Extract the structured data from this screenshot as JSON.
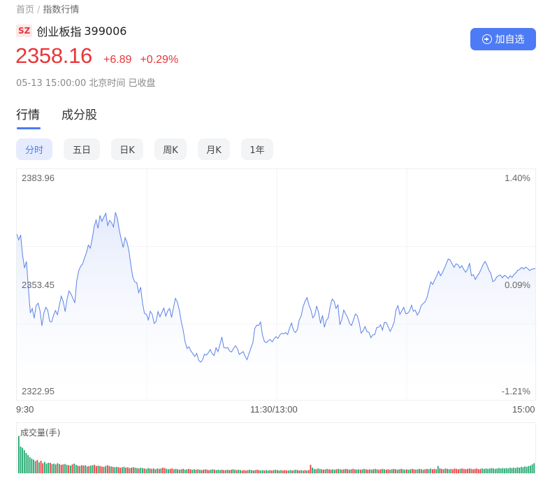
{
  "breadcrumb": {
    "home": "首页",
    "separator": "/",
    "current": "指数行情"
  },
  "index": {
    "market": "SZ",
    "name": "创业板指",
    "code": "399006"
  },
  "watch_button": {
    "label": "加自选",
    "icon": "plus-circle-icon"
  },
  "quote": {
    "price": "2358.16",
    "change": "+6.89",
    "change_pct": "+0.29%"
  },
  "status": "05-13 15:00:00 北京时间 已收盘",
  "tabs": [
    {
      "label": "行情",
      "active": true
    },
    {
      "label": "成分股",
      "active": false
    }
  ],
  "periods": [
    {
      "label": "分时",
      "active": true
    },
    {
      "label": "五日",
      "active": false
    },
    {
      "label": "日K",
      "active": false
    },
    {
      "label": "周K",
      "active": false
    },
    {
      "label": "月K",
      "active": false
    },
    {
      "label": "1年",
      "active": false
    }
  ],
  "colors": {
    "up": "#e8363a",
    "down": "#1aa56a",
    "line": "#5b82e8",
    "accent": "#4d7bf5"
  },
  "chart_data": {
    "type": "line",
    "y_left_ticks": [
      "2383.96",
      "2353.45",
      "2322.95"
    ],
    "y_right_ticks": [
      "1.40%",
      "0.09%",
      "-1.21%"
    ],
    "x_ticks": [
      "9:30",
      "11:30/13:00",
      "15:00"
    ],
    "ylim": [
      2322.95,
      2383.96
    ],
    "prev_close": 2351.27,
    "series": [
      {
        "values": [
          2368.2,
          2366.5,
          2367.9,
          2362.1,
          2358.4,
          2360.3,
          2352.7,
          2345.5,
          2346.8,
          2344.0,
          2347.6,
          2348.3,
          2346.2,
          2341.8,
          2345.4,
          2347.1,
          2346.3,
          2343.1,
          2342.9,
          2344.8,
          2346.2,
          2345.0,
          2347.7,
          2350.3,
          2348.8,
          2345.9,
          2349.5,
          2351.8,
          2351.0,
          2349.7,
          2348.4,
          2354.8,
          2357.6,
          2358.9,
          2359.5,
          2361.3,
          2362.8,
          2365.0,
          2364.1,
          2366.8,
          2370.3,
          2372.2,
          2369.8,
          2373.5,
          2371.8,
          2373.0,
          2374.1,
          2370.6,
          2372.1,
          2371.4,
          2370.2,
          2374.4,
          2372.7,
          2369.2,
          2366.6,
          2364.3,
          2367.1,
          2365.8,
          2363.2,
          2359.1,
          2355.7,
          2354.4,
          2354.2,
          2351.3,
          2352.9,
          2348.3,
          2345.4,
          2345.1,
          2343.5,
          2346.0,
          2345.1,
          2342.5,
          2343.1,
          2345.9,
          2344.4,
          2345.7,
          2346.9,
          2344.6,
          2346.1,
          2346.8,
          2344.2,
          2347.1,
          2349.7,
          2348.6,
          2346.3,
          2343.1,
          2340.6,
          2337.2,
          2335.3,
          2335.8,
          2334.6,
          2333.8,
          2333.0,
          2333.9,
          2331.9,
          2331.4,
          2332.0,
          2333.7,
          2333.4,
          2334.1,
          2335.0,
          2333.8,
          2333.3,
          2335.5,
          2334.4,
          2336.4,
          2338.6,
          2335.6,
          2335.4,
          2335.6,
          2334.6,
          2334.3,
          2335.3,
          2336.1,
          2335.3,
          2333.6,
          2334.0,
          2334.4,
          2333.1,
          2332.1,
          2333.8,
          2335.4,
          2337.0,
          2341.0,
          2342.0,
          2341.9,
          2342.9,
          2339.1,
          2337.3,
          2337.0,
          2337.5,
          2337.9,
          2337.2,
          2338.1,
          2338.7,
          2338.2,
          2339.2,
          2339.7,
          2339.5,
          2339.9,
          2339.3,
          2341.2,
          2342.6,
          2340.5,
          2339.9,
          2340.7,
          2343.5,
          2344.7,
          2347.3,
          2348.9,
          2349.9,
          2347.8,
          2346.4,
          2344.1,
          2344.9,
          2347.5,
          2345.6,
          2342.5,
          2344.8,
          2341.4,
          2343.4,
          2344.1,
          2347.4,
          2349.5,
          2348.9,
          2346.8,
          2347.8,
          2342.1,
          2343.7,
          2346.3,
          2345.2,
          2344.2,
          2342.5,
          2341.9,
          2343.5,
          2345.2,
          2344.7,
          2342.6,
          2339.7,
          2340.4,
          2341.6,
          2340.1,
          2340.0,
          2338.4,
          2339.2,
          2339.3,
          2341.3,
          2341.4,
          2342.1,
          2340.6,
          2342.8,
          2342.7,
          2341.5,
          2340.2,
          2341.4,
          2342.8,
          2346.4,
          2347.6,
          2345.1,
          2346.1,
          2347.1,
          2345.3,
          2345.4,
          2346.1,
          2347.7,
          2346.0,
          2346.3,
          2344.9,
          2345.8,
          2347.6,
          2348.2,
          2348.7,
          2349.9,
          2352.2,
          2354.4,
          2353.7,
          2355.0,
          2356.1,
          2357.5,
          2356.2,
          2357.1,
          2358.3,
          2359.7,
          2361.0,
          2360.7,
          2359.6,
          2358.6,
          2359.6,
          2359.4,
          2358.4,
          2359.1,
          2358.0,
          2357.2,
          2358.1,
          2359.8,
          2356.2,
          2356.5,
          2355.1,
          2356.1,
          2356.9,
          2358.1,
          2359.4,
          2360.3,
          2359.3,
          2357.8,
          2356.9,
          2354.5,
          2354.8,
          2355.8,
          2356.2,
          2356.4,
          2355.6,
          2356.3,
          2356.0,
          2355.4,
          2356.2,
          2355.7,
          2356.6,
          2357.0,
          2357.8,
          2358.0,
          2358.6,
          2358.1,
          2358.7,
          2358.3,
          2357.7,
          2358.0,
          2358.2,
          2358.2
        ]
      }
    ],
    "volume": {
      "title": "成交量(手)",
      "values": [
        0.92,
        0.66,
        0.63,
        0.57,
        0.5,
        0.45,
        0.4,
        0.36,
        0.34,
        0.3,
        0.33,
        0.27,
        0.31,
        0.25,
        0.28,
        0.24,
        0.26,
        0.26,
        0.23,
        0.24,
        0.22,
        0.25,
        0.23,
        0.21,
        0.22,
        0.23,
        0.21,
        0.2,
        0.19,
        0.22,
        0.24,
        0.21,
        0.19,
        0.18,
        0.2,
        0.19,
        0.2,
        0.17,
        0.18,
        0.19,
        0.2,
        0.21,
        0.18,
        0.19,
        0.18,
        0.17,
        0.16,
        0.18,
        0.2,
        0.18,
        0.17,
        0.16,
        0.15,
        0.16,
        0.15,
        0.14,
        0.15,
        0.16,
        0.14,
        0.15,
        0.13,
        0.14,
        0.15,
        0.14,
        0.13,
        0.12,
        0.14,
        0.13,
        0.12,
        0.11,
        0.13,
        0.12,
        0.11,
        0.12,
        0.1,
        0.12,
        0.11,
        0.12,
        0.14,
        0.13,
        0.11,
        0.1,
        0.11,
        0.12,
        0.1,
        0.11,
        0.1,
        0.09,
        0.1,
        0.11,
        0.09,
        0.1,
        0.11,
        0.1,
        0.09,
        0.1,
        0.09,
        0.1,
        0.09,
        0.08,
        0.09,
        0.1,
        0.09,
        0.08,
        0.09,
        0.1,
        0.09,
        0.08,
        0.09,
        0.08,
        0.09,
        0.08,
        0.08,
        0.09,
        0.08,
        0.09,
        0.1,
        0.09,
        0.08,
        0.09,
        0.08,
        0.07,
        0.08,
        0.07,
        0.08,
        0.09,
        0.08,
        0.07,
        0.08,
        0.09,
        0.08,
        0.07,
        0.08,
        0.07,
        0.08,
        0.07,
        0.08,
        0.07,
        0.08,
        0.09,
        0.08,
        0.07,
        0.08,
        0.07,
        0.08,
        0.07,
        0.07,
        0.08,
        0.07,
        0.08,
        0.09,
        0.08,
        0.07,
        0.08,
        0.07,
        0.08,
        0.07,
        0.08,
        0.21,
        0.14,
        0.11,
        0.1,
        0.12,
        0.11,
        0.1,
        0.09,
        0.1,
        0.11,
        0.1,
        0.09,
        0.1,
        0.09,
        0.1,
        0.11,
        0.1,
        0.09,
        0.1,
        0.11,
        0.1,
        0.09,
        0.1,
        0.11,
        0.1,
        0.09,
        0.1,
        0.09,
        0.1,
        0.11,
        0.1,
        0.09,
        0.1,
        0.09,
        0.1,
        0.11,
        0.1,
        0.09,
        0.1,
        0.11,
        0.1,
        0.09,
        0.1,
        0.09,
        0.1,
        0.11,
        0.1,
        0.09,
        0.1,
        0.11,
        0.1,
        0.09,
        0.1,
        0.09,
        0.1,
        0.11,
        0.1,
        0.09,
        0.1,
        0.11,
        0.1,
        0.09,
        0.1,
        0.11,
        0.1,
        0.12,
        0.1,
        0.11,
        0.1,
        0.18,
        0.12,
        0.11,
        0.1,
        0.12,
        0.11,
        0.1,
        0.11,
        0.1,
        0.12,
        0.11,
        0.1,
        0.11,
        0.12,
        0.11,
        0.1,
        0.11,
        0.12,
        0.11,
        0.1,
        0.11,
        0.12,
        0.1,
        0.11,
        0.12,
        0.11,
        0.12,
        0.11,
        0.12,
        0.13,
        0.12,
        0.11,
        0.12,
        0.13,
        0.12,
        0.13,
        0.12,
        0.13,
        0.12,
        0.14,
        0.13,
        0.14,
        0.13,
        0.15,
        0.14,
        0.16,
        0.15,
        0.17,
        0.16,
        0.18,
        0.19,
        0.22,
        0.25
      ],
      "directions": "dddddddddduduuddduddudduuddududduduuddudduuduudduududduudduuduuddudduddududduduudduudduddudduuddudduuduudduddduudduuddudduuuddduduuddudduuddudduuuddudduudduduuddudduudduuddudduduudduuddudduuddudduudduudduudduddudduuddudduudduudduuddudduuuuduuuuuduuuuu"
    }
  }
}
